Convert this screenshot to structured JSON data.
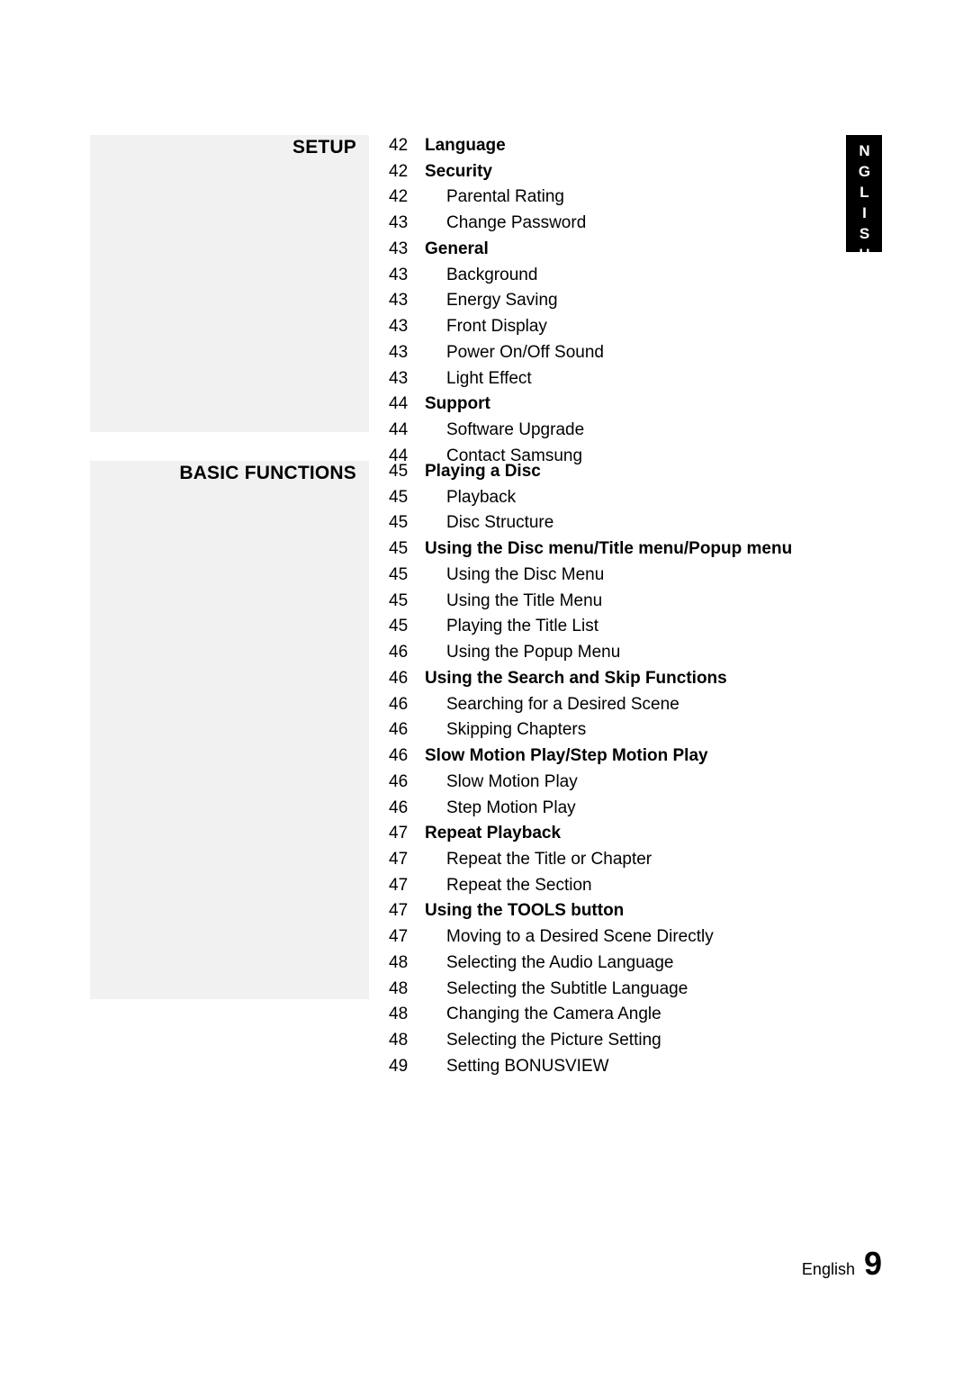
{
  "edge_tab": "ENGLISH",
  "sections": [
    {
      "label": "SETUP"
    },
    {
      "label": "BASIC FUNCTIONS"
    }
  ],
  "setup_items": [
    {
      "page": "42",
      "title": "Language",
      "bold": true,
      "sub": false
    },
    {
      "page": "42",
      "title": "Security",
      "bold": true,
      "sub": false
    },
    {
      "page": "42",
      "title": "Parental Rating",
      "bold": false,
      "sub": true
    },
    {
      "page": "43",
      "title": "Change Password",
      "bold": false,
      "sub": true
    },
    {
      "page": "43",
      "title": "General",
      "bold": true,
      "sub": false
    },
    {
      "page": "43",
      "title": "Background",
      "bold": false,
      "sub": true
    },
    {
      "page": "43",
      "title": "Energy Saving",
      "bold": false,
      "sub": true
    },
    {
      "page": "43",
      "title": "Front Display",
      "bold": false,
      "sub": true
    },
    {
      "page": "43",
      "title": "Power On/Off Sound",
      "bold": false,
      "sub": true
    },
    {
      "page": "43",
      "title": "Light Effect",
      "bold": false,
      "sub": true
    },
    {
      "page": "44",
      "title": "Support",
      "bold": true,
      "sub": false
    },
    {
      "page": "44",
      "title": "Software Upgrade",
      "bold": false,
      "sub": true
    },
    {
      "page": "44",
      "title": "Contact Samsung",
      "bold": false,
      "sub": true
    }
  ],
  "basic_items": [
    {
      "page": "45",
      "title": "Playing a Disc",
      "bold": true,
      "sub": false
    },
    {
      "page": "45",
      "title": "Playback",
      "bold": false,
      "sub": true
    },
    {
      "page": "45",
      "title": "Disc Structure",
      "bold": false,
      "sub": true
    },
    {
      "page": "45",
      "title": "Using the Disc menu/Title menu/Popup menu",
      "bold": true,
      "sub": false
    },
    {
      "page": "45",
      "title": "Using the Disc Menu",
      "bold": false,
      "sub": true
    },
    {
      "page": "45",
      "title": "Using the Title Menu",
      "bold": false,
      "sub": true
    },
    {
      "page": "45",
      "title": "Playing the Title List",
      "bold": false,
      "sub": true
    },
    {
      "page": "46",
      "title": "Using the Popup Menu",
      "bold": false,
      "sub": true
    },
    {
      "page": "46",
      "title": "Using the Search and Skip Functions",
      "bold": true,
      "sub": false
    },
    {
      "page": "46",
      "title": "Searching for a Desired Scene",
      "bold": false,
      "sub": true
    },
    {
      "page": "46",
      "title": "Skipping Chapters",
      "bold": false,
      "sub": true
    },
    {
      "page": "46",
      "title": "Slow Motion Play/Step Motion Play",
      "bold": true,
      "sub": false
    },
    {
      "page": "46",
      "title": "Slow Motion Play",
      "bold": false,
      "sub": true
    },
    {
      "page": "46",
      "title": "Step Motion Play",
      "bold": false,
      "sub": true
    },
    {
      "page": "47",
      "title": "Repeat Playback",
      "bold": true,
      "sub": false
    },
    {
      "page": "47",
      "title": "Repeat the Title or Chapter",
      "bold": false,
      "sub": true
    },
    {
      "page": "47",
      "title": "Repeat the Section",
      "bold": false,
      "sub": true
    },
    {
      "page": "47",
      "title": "Using the TOOLS button",
      "bold": true,
      "sub": false
    },
    {
      "page": "47",
      "title": "Moving to a Desired Scene Directly",
      "bold": false,
      "sub": true
    },
    {
      "page": "48",
      "title": "Selecting the Audio Language",
      "bold": false,
      "sub": true
    },
    {
      "page": "48",
      "title": "Selecting the Subtitle Language",
      "bold": false,
      "sub": true
    },
    {
      "page": "48",
      "title": "Changing the Camera Angle",
      "bold": false,
      "sub": true
    },
    {
      "page": "48",
      "title": "Selecting the Picture Setting",
      "bold": false,
      "sub": true
    },
    {
      "page": "49",
      "title": "Setting BONUSVIEW",
      "bold": false,
      "sub": true
    }
  ],
  "footer": {
    "lang": "English",
    "page_number": "9"
  }
}
